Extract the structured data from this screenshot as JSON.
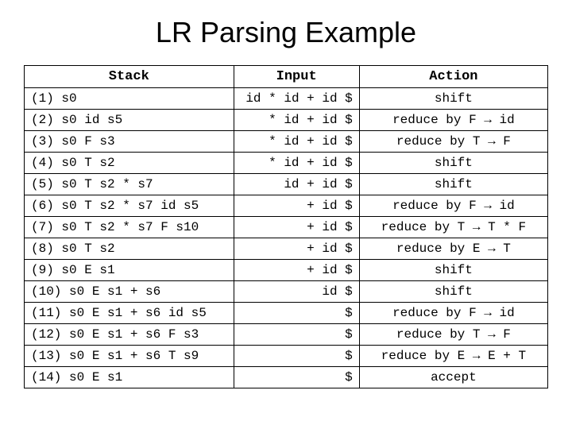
{
  "title": "LR Parsing Example",
  "headers": {
    "stack": "Stack",
    "input": "Input",
    "action": "Action"
  },
  "arrow": "→",
  "rows": [
    {
      "n": "(1)",
      "stack": "s0",
      "input": "id * id + id $",
      "action": "shift"
    },
    {
      "n": "(2)",
      "stack": "s0 id s5",
      "input": "* id + id $",
      "action": "reduce by F → id"
    },
    {
      "n": "(3)",
      "stack": "s0 F s3",
      "input": "* id + id $",
      "action": "reduce by T → F"
    },
    {
      "n": "(4)",
      "stack": "s0 T s2",
      "input": "* id + id $",
      "action": "shift"
    },
    {
      "n": "(5)",
      "stack": "s0 T s2 * s7",
      "input": "id + id $",
      "action": "shift"
    },
    {
      "n": "(6)",
      "stack": "s0 T s2 * s7 id s5",
      "input": "+ id $",
      "action": "reduce by F → id"
    },
    {
      "n": "(7)",
      "stack": "s0 T s2 * s7 F s10",
      "input": "+ id $",
      "action": "reduce by T → T * F"
    },
    {
      "n": "(8)",
      "stack": "s0 T s2",
      "input": "+ id $",
      "action": "reduce by E → T"
    },
    {
      "n": "(9)",
      "stack": "s0 E s1",
      "input": "+ id $",
      "action": "shift"
    },
    {
      "n": "(10)",
      "stack": "s0 E s1 + s6",
      "input": "id $",
      "action": "shift"
    },
    {
      "n": "(11)",
      "stack": "s0 E s1 + s6 id s5",
      "input": "$",
      "action": "reduce by F → id"
    },
    {
      "n": "(12)",
      "stack": "s0 E s1 + s6 F s3",
      "input": "$",
      "action": "reduce by T → F"
    },
    {
      "n": "(13)",
      "stack": "s0 E s1 + s6 T s9",
      "input": "$",
      "action": "reduce by E → E + T"
    },
    {
      "n": "(14)",
      "stack": "s0 E s1",
      "input": "$",
      "action": "accept"
    }
  ]
}
